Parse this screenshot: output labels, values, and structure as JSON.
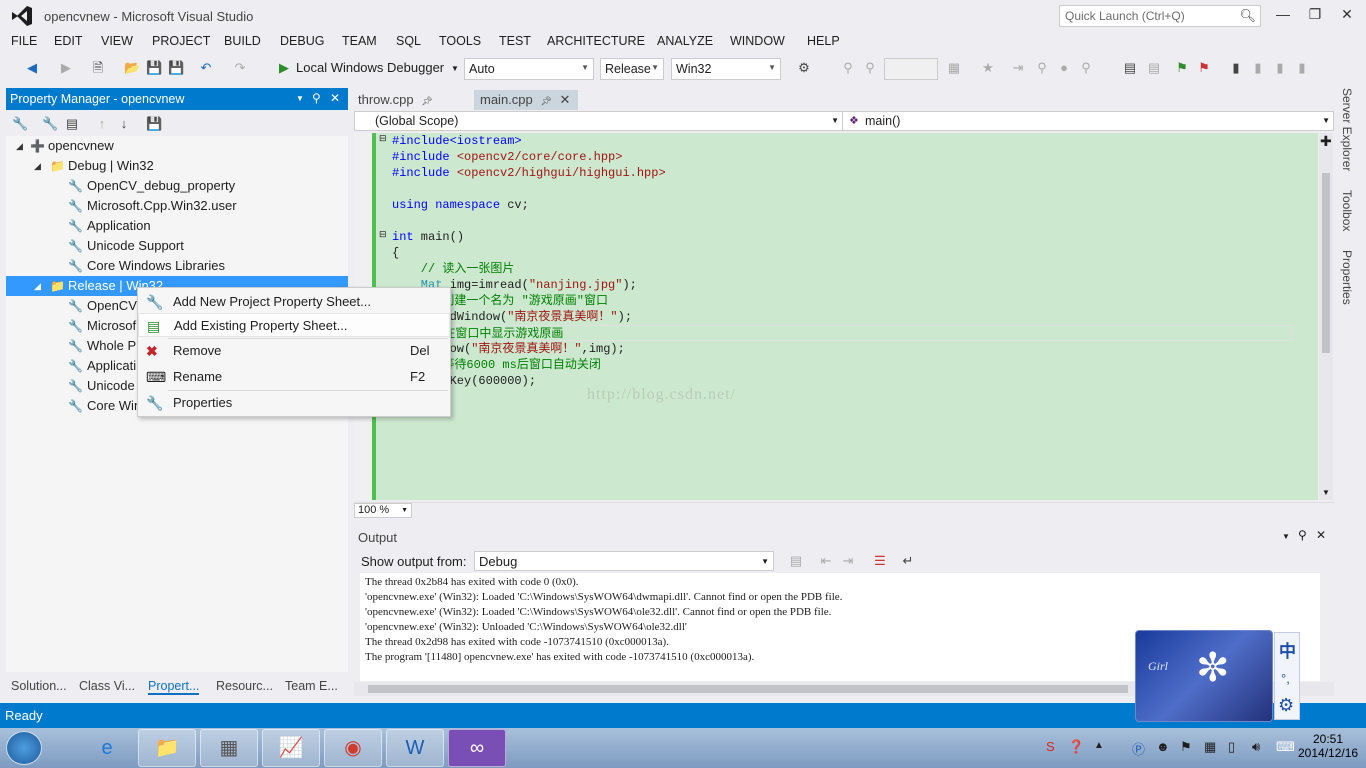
{
  "window": {
    "title": "opencvnew - Microsoft Visual Studio",
    "quick_launch_placeholder": "Quick Launch (Ctrl+Q)"
  },
  "menu": [
    "FILE",
    "EDIT",
    "VIEW",
    "PROJECT",
    "BUILD",
    "DEBUG",
    "TEAM",
    "SQL",
    "TOOLS",
    "TEST",
    "ARCHITECTURE",
    "ANALYZE",
    "WINDOW",
    "HELP"
  ],
  "toolbar": {
    "debugger": "Local Windows Debugger",
    "solution_config_auto": "Auto",
    "configuration": "Release",
    "platform": "Win32"
  },
  "property_manager": {
    "title": "Property Manager - opencvnew",
    "tree": {
      "project": "opencvnew",
      "debug_config": "Debug | Win32",
      "debug_items": [
        "OpenCV_debug_property",
        "Microsoft.Cpp.Win32.user",
        "Application",
        "Unicode Support",
        "Core Windows Libraries"
      ],
      "release_config": "Release | Win32",
      "release_items": [
        "OpenCV",
        "Microsof",
        "Whole P",
        "Applicati",
        "Unicode",
        "Core Win"
      ]
    },
    "bottom_tabs": [
      "Solution...",
      "Class Vi...",
      "Propert...",
      "Resourc...",
      "Team E..."
    ]
  },
  "context_menu": [
    {
      "label": "Add New Project Property Sheet...",
      "shortcut": ""
    },
    {
      "label": "Add Existing Property Sheet...",
      "shortcut": ""
    },
    {
      "label": "Remove",
      "shortcut": "Del"
    },
    {
      "label": "Rename",
      "shortcut": "F2"
    },
    {
      "label": "Properties",
      "shortcut": ""
    }
  ],
  "editor": {
    "tabs": [
      "throw.cpp",
      "main.cpp"
    ],
    "scope": "(Global Scope)",
    "function": "main()",
    "zoom": "100 %",
    "watermark": "http://blog.csdn.net/",
    "code": {
      "l1": "#include<iostream>",
      "l2a": "#include ",
      "l2b": "<opencv2/core/core.hpp>",
      "l3a": "#include ",
      "l3b": "<opencv2/highgui/highgui.hpp>",
      "l5a": "using namespace",
      "l5b": " cv;",
      "l7a": "int",
      "l7b": " main()",
      "l8": "{",
      "l9": "    // 读入一张图片",
      "l10a": "    Mat",
      "l10b": " img=imread(",
      "l10c": "\"nanjing.jpg\"",
      "l10d": ");",
      "l11a": "    // 创建一个名为 \"游戏原画\"窗口",
      "l12a": "    namedWindow(",
      "l12b": "\"南京夜景真美啊！\"",
      "l12c": ");",
      "l13": "    // 在窗口中显示游戏原画",
      "l14a": "    imshow(",
      "l14b": "\"南京夜景真美啊！\"",
      "l14c": ",img);",
      "l15": "    // 等待6000 ms后窗口自动关闭",
      "l16": "    waitKey(600000);"
    }
  },
  "output": {
    "title": "Output",
    "show_from_label": "Show output from:",
    "source": "Debug",
    "lines": [
      "The thread 0x2b84 has exited with code 0 (0x0).",
      "'opencvnew.exe' (Win32): Loaded 'C:\\Windows\\SysWOW64\\dwmapi.dll'. Cannot find or open the PDB file.",
      "'opencvnew.exe' (Win32): Loaded 'C:\\Windows\\SysWOW64\\ole32.dll'. Cannot find or open the PDB file.",
      "'opencvnew.exe' (Win32): Unloaded 'C:\\Windows\\SysWOW64\\ole32.dll'",
      "The thread 0x2d98 has exited with code -1073741510 (0xc000013a).",
      "The program '[11480] opencvnew.exe' has exited with code -1073741510 (0xc000013a)."
    ]
  },
  "side_tabs": [
    "Server Explorer",
    "Toolbox",
    "Properties"
  ],
  "status": "Ready",
  "ime": {
    "lang": "中",
    "brand": "Girl"
  },
  "taskbar": {
    "time": "20:51",
    "date": "2014/12/16"
  },
  "colors": {
    "accent": "#007acc",
    "editor_bg": "#cce8cf",
    "selection": "#3399ff"
  }
}
